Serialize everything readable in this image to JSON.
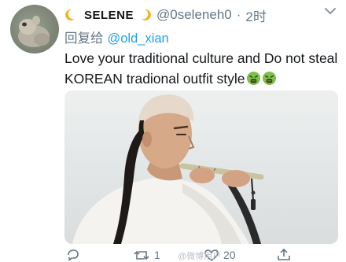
{
  "tweet": {
    "display_name": "SELENE",
    "handle": "@0seleneh0",
    "separator": "·",
    "time": "2时",
    "reply_prefix": "回复给",
    "reply_mention": "@old_xian",
    "text": "Love your traditional culture and Do not steal KOREAN tradional outfit style",
    "emoji_icons": [
      "nauseated-face-icon",
      "nauseated-face-icon"
    ],
    "media_image": "photo of a man with shaved forehead and queue hairstyle playing a flute"
  },
  "actions": {
    "reply_count": "",
    "retweet_count": "1",
    "like_count": "20"
  },
  "watermark": "@微博用户",
  "colors": {
    "link": "#1da1f2",
    "secondary_text": "#657786",
    "primary_text": "#14171a"
  }
}
